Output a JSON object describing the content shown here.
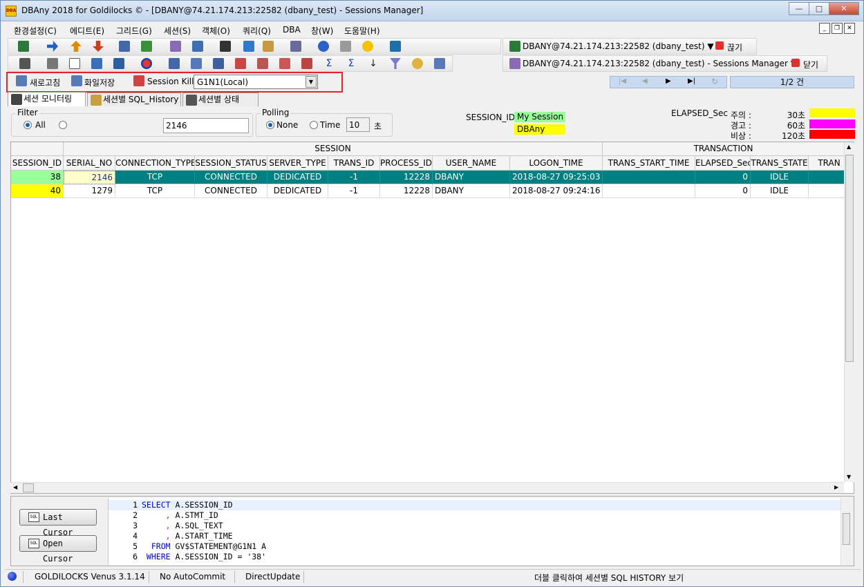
{
  "window": {
    "title": "DBAny 2018 for Goldilocks © - [DBANY@74.21.174.213:22582 (dbany_test) - Sessions Manager]",
    "app_icon_label": "DBA"
  },
  "menu": [
    "환경설정(C)",
    "에디트(E)",
    "그리드(G)",
    "세션(S)",
    "객체(O)",
    "쿼리(Q)",
    "DBA",
    "창(W)",
    "도움말(H)"
  ],
  "toolbar": {
    "connection1": "DBANY@74.21.174.213:22582 (dbany_test) ▼",
    "disconnect_label": "끊기",
    "connection2": "DBANY@74.21.174.213:22582 (dbany_test) - Sessions Manager ▼",
    "close_label": "닫기"
  },
  "actionbar": {
    "refresh_label": "새로고침",
    "save_label": "화일저장",
    "kill_label": "Session Kill",
    "instance_value": "G1N1(Local)",
    "page_info": "1/2 건"
  },
  "tabs": [
    "세션 모니터링",
    "세션별 SQL_History",
    "세션별 상태"
  ],
  "filter": {
    "caption": "Filter",
    "all_label": "All",
    "value": "2146"
  },
  "polling": {
    "caption": "Polling",
    "none_label": "None",
    "time_label": "Time",
    "time_value": "10",
    "unit": "초"
  },
  "session_legend": {
    "label": "SESSION_ID",
    "my_session": "My Session",
    "dbany": "DBAny",
    "my_session_color": "#99ff99",
    "dbany_color": "#ffff00"
  },
  "elapsed_legend": {
    "label": "ELAPSED_Sec",
    "levels": [
      {
        "name": "주의 :",
        "value": "30초",
        "color": "#ffff00"
      },
      {
        "name": "경고 :",
        "value": "60초",
        "color": "#ff00ff"
      },
      {
        "name": "비상 :",
        "value": "120초",
        "color": "#ff0000"
      }
    ]
  },
  "grid": {
    "group_headers": [
      "SESSION",
      "TRANSACTION"
    ],
    "columns": [
      "SESSION_ID",
      "SERIAL_NO",
      "CONNECTION_TYPE",
      "SESSION_STATUS",
      "SERVER_TYPE",
      "TRANS_ID",
      "PROCESS_ID",
      "USER_NAME",
      "LOGON_TIME",
      "TRANS_START_TIME",
      "ELAPSED_Sec",
      "TRANS_STATE",
      "TRAN"
    ],
    "rows": [
      [
        "38",
        "2146",
        "TCP",
        "CONNECTED",
        "DEDICATED",
        "-1",
        "12228",
        "DBANY",
        "2018-08-27 09:25:03",
        "",
        "0",
        "IDLE",
        ""
      ],
      [
        "40",
        "1279",
        "TCP",
        "CONNECTED",
        "DEDICATED",
        "-1",
        "12228",
        "DBANY",
        "2018-08-27 09:24:16",
        "",
        "0",
        "IDLE",
        ""
      ]
    ],
    "selected_color": "#008080"
  },
  "buttons": {
    "last_cursor": "Last Cursor",
    "open_cursor": "Open Cursor"
  },
  "sql_lines": [
    {
      "n": "1",
      "a": "SELECT",
      "b": " A.SESSION_ID"
    },
    {
      "n": "2",
      "a": "     ,",
      "b": " A.STMT_ID"
    },
    {
      "n": "3",
      "a": "     ,",
      "b": " A.SQL_TEXT"
    },
    {
      "n": "4",
      "a": "     ,",
      "b": " A.START_TIME"
    },
    {
      "n": "5",
      "a": "  FROM",
      "b": " GV$STATEMENT@G1N1 A"
    },
    {
      "n": "6",
      "a": " WHERE",
      "b": " A.SESSION_ID = '38'"
    }
  ],
  "status": {
    "server": "GOLDILOCKS Venus 3.1.14",
    "commit": "No AutoCommit",
    "update": "DirectUpdate",
    "hint": "더블 클릭하여 세션별 SQL HISTORY 보기"
  }
}
